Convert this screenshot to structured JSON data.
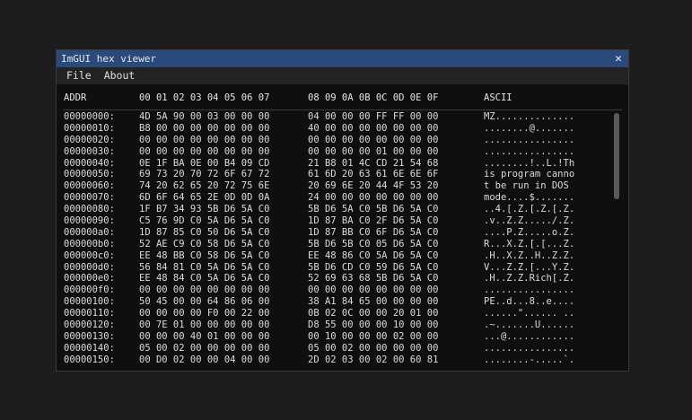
{
  "window": {
    "title": "ImGUI hex viewer",
    "close_glyph": "✕"
  },
  "menu": [
    {
      "label": "File"
    },
    {
      "label": "About"
    }
  ],
  "table": {
    "header": {
      "addr": "ADDR",
      "hex1": "00 01 02 03 04 05 06 07",
      "hex2": "08 09 0A 0B 0C 0D 0E 0F",
      "ascii": "ASCII"
    },
    "rows": [
      {
        "addr": "00000000:",
        "hex1": "4D 5A 90 00 03 00 00 00",
        "hex2": "04 00 00 00 FF FF 00 00",
        "ascii": "MZ.............."
      },
      {
        "addr": "00000010:",
        "hex1": "B8 00 00 00 00 00 00 00",
        "hex2": "40 00 00 00 00 00 00 00",
        "ascii": "........@......."
      },
      {
        "addr": "00000020:",
        "hex1": "00 00 00 00 00 00 00 00",
        "hex2": "00 00 00 00 00 00 00 00",
        "ascii": "................"
      },
      {
        "addr": "00000030:",
        "hex1": "00 00 00 00 00 00 00 00",
        "hex2": "00 00 00 00 01 00 00 00",
        "ascii": "................"
      },
      {
        "addr": "00000040:",
        "hex1": "0E 1F BA 0E 00 B4 09 CD",
        "hex2": "21 B8 01 4C CD 21 54 68",
        "ascii": "........!..L.!Th"
      },
      {
        "addr": "00000050:",
        "hex1": "69 73 20 70 72 6F 67 72",
        "hex2": "61 6D 20 63 61 6E 6E 6F",
        "ascii": "is program canno"
      },
      {
        "addr": "00000060:",
        "hex1": "74 20 62 65 20 72 75 6E",
        "hex2": "20 69 6E 20 44 4F 53 20",
        "ascii": "t be run in DOS "
      },
      {
        "addr": "00000070:",
        "hex1": "6D 6F 64 65 2E 0D 0D 0A",
        "hex2": "24 00 00 00 00 00 00 00",
        "ascii": "mode....$......."
      },
      {
        "addr": "00000080:",
        "hex1": "1F B7 34 93 5B D6 5A C0",
        "hex2": "5B D6 5A C0 5B D6 5A C0",
        "ascii": "..4.[.Z.[.Z.[.Z."
      },
      {
        "addr": "00000090:",
        "hex1": "C5 76 9D C0 5A D6 5A C0",
        "hex2": "1D 87 BA C0 2F D6 5A C0",
        "ascii": ".v..Z.Z...../.Z."
      },
      {
        "addr": "000000a0:",
        "hex1": "1D 87 85 C0 50 D6 5A C0",
        "hex2": "1D 87 BB C0 6F D6 5A C0",
        "ascii": "....P.Z.....o.Z."
      },
      {
        "addr": "000000b0:",
        "hex1": "52 AE C9 C0 58 D6 5A C0",
        "hex2": "5B D6 5B C0 05 D6 5A C0",
        "ascii": "R...X.Z.[.[...Z."
      },
      {
        "addr": "000000c0:",
        "hex1": "EE 48 BB C0 58 D6 5A C0",
        "hex2": "EE 48 86 C0 5A D6 5A C0",
        "ascii": ".H..X.Z..H..Z.Z."
      },
      {
        "addr": "000000d0:",
        "hex1": "56 84 81 C0 5A D6 5A C0",
        "hex2": "5B D6 CD C0 59 D6 5A C0",
        "ascii": "V...Z.Z.[...Y.Z."
      },
      {
        "addr": "000000e0:",
        "hex1": "EE 48 84 C0 5A D6 5A C0",
        "hex2": "52 69 63 68 5B D6 5A C0",
        "ascii": ".H..Z.Z.Rich[.Z."
      },
      {
        "addr": "000000f0:",
        "hex1": "00 00 00 00 00 00 00 00",
        "hex2": "00 00 00 00 00 00 00 00",
        "ascii": "................"
      },
      {
        "addr": "00000100:",
        "hex1": "50 45 00 00 64 86 06 00",
        "hex2": "38 A1 84 65 00 00 00 00",
        "ascii": "PE..d...8..e...."
      },
      {
        "addr": "00000110:",
        "hex1": "00 00 00 00 F0 00 22 00",
        "hex2": "0B 02 0C 00 00 20 01 00",
        "ascii": "......\"...... .."
      },
      {
        "addr": "00000120:",
        "hex1": "00 7E 01 00 00 00 00 00",
        "hex2": "D8 55 00 00 00 10 00 00",
        "ascii": ".~.......U......"
      },
      {
        "addr": "00000130:",
        "hex1": "00 00 00 40 01 00 00 00",
        "hex2": "00 10 00 00 00 02 00 00",
        "ascii": "...@............"
      },
      {
        "addr": "00000140:",
        "hex1": "05 00 02 00 00 00 00 00",
        "hex2": "05 00 02 00 00 00 00 00",
        "ascii": "................"
      },
      {
        "addr": "00000150:",
        "hex1": "00 D0 02 00 00 04 00 00",
        "hex2": "2D 02 03 00 02 00 60 81",
        "ascii": "........-.....`."
      }
    ]
  },
  "colors": {
    "titlebar": "#294a7a",
    "background": "#0f0f0f",
    "text": "#dcdcdc"
  }
}
